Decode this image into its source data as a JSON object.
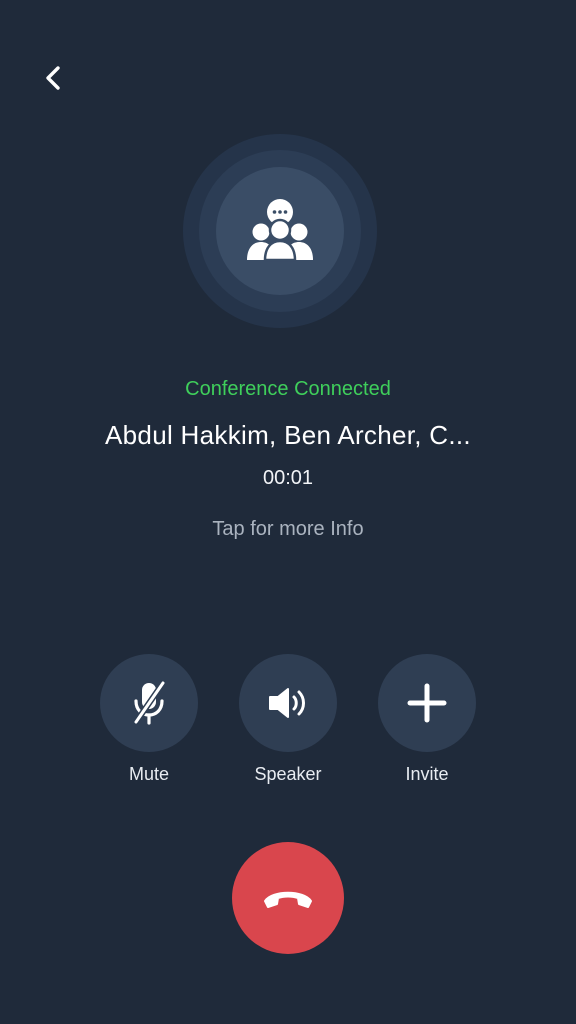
{
  "header": {
    "back_icon": "chevron-left-icon"
  },
  "avatar": {
    "icon": "group-chat-icon"
  },
  "call": {
    "status": "Conference Connected",
    "participants": "Abdul Hakkim, Ben Archer, C...",
    "timer": "00:01",
    "info_hint": "Tap for more Info"
  },
  "actions": [
    {
      "label": "Mute",
      "icon": "mic-off-icon"
    },
    {
      "label": "Speaker",
      "icon": "speaker-icon"
    },
    {
      "label": "Invite",
      "icon": "plus-icon"
    }
  ],
  "hangup": {
    "icon": "phone-hangup-icon"
  },
  "colors": {
    "background": "#1f2a3a",
    "status_green": "#3fcf5b",
    "hangup_red": "#d9464d",
    "action_circle": "#2f3e53"
  }
}
